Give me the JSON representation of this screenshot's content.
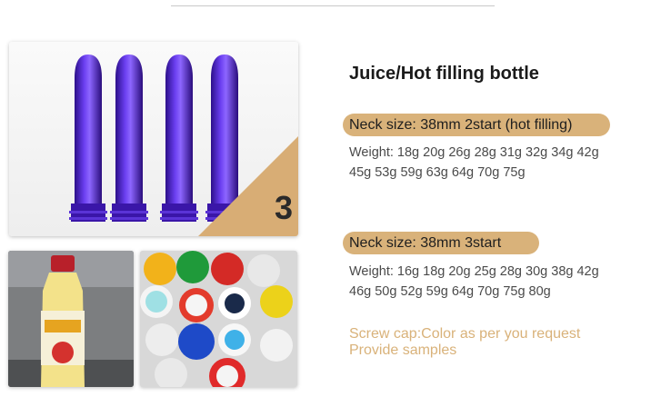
{
  "product": {
    "title": "Juice/Hot filling bottle",
    "badge_number": "3"
  },
  "specs": [
    {
      "neck_label": "Neck size: 38mm 2start (hot filling)",
      "weights_line1": "Weight: 18g 20g 26g 28g 31g 32g 34g 42g",
      "weights_line2": "45g 53g 59g 63g 64g 70g 75g"
    },
    {
      "neck_label": "Neck size: 38mm 3start",
      "weights_line1": "Weight: 16g 18g 20g 25g 28g 30g 38g 42g",
      "weights_line2": "46g 50g 52g 59g 64g 70g 75g 80g"
    }
  ],
  "notes": {
    "line1": "Screw cap:Color as per you request",
    "line2": "Provide samples"
  },
  "colors": {
    "accent": "#d9b27a",
    "preform": "#4a1fc8"
  },
  "images": {
    "main": "purple-preform-image",
    "juice": "juice-bottle-image",
    "caps": "colored-caps-image"
  }
}
